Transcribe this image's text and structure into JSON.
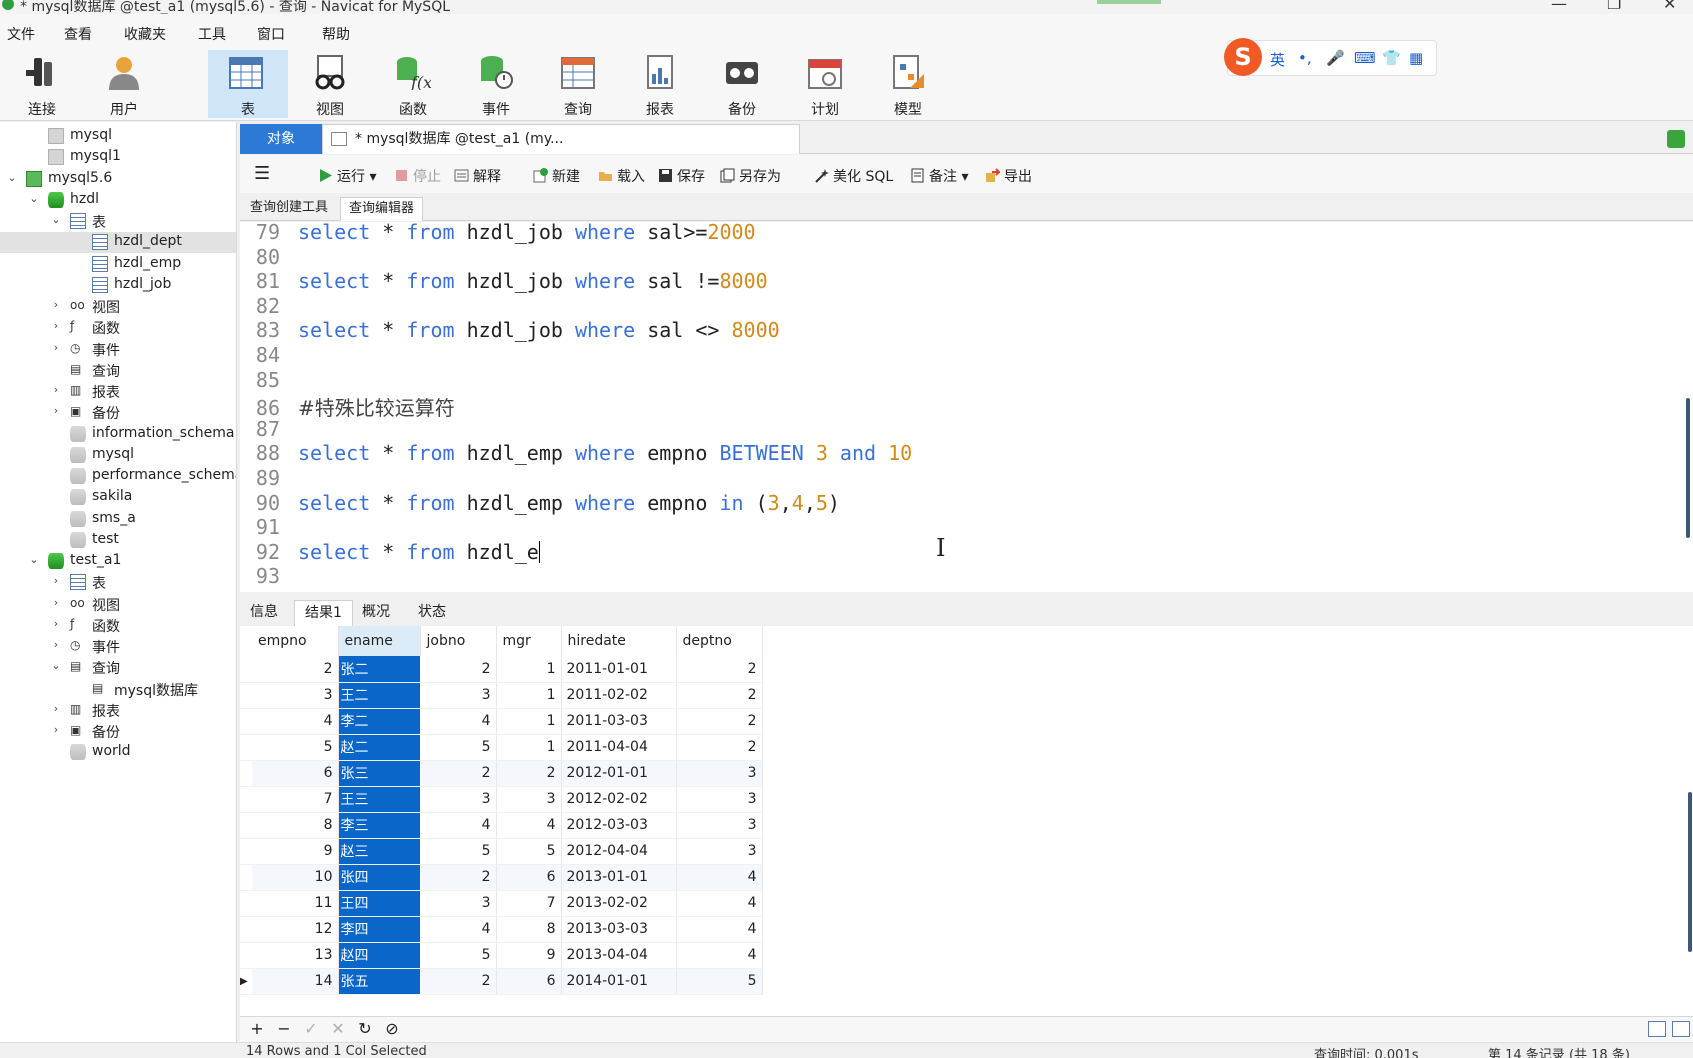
{
  "window": {
    "title": "* mysql数据库 @test_a1 (mysql5.6) - 查询 - Navicat for MySQL",
    "minimize": "—",
    "maximize": "❐",
    "close": "✕"
  },
  "menu": [
    "文件",
    "查看",
    "收藏夹",
    "工具",
    "窗口",
    "帮助"
  ],
  "ribbon": [
    {
      "label": "连接",
      "icon": "connection-icon"
    },
    {
      "label": "用户",
      "icon": "user-icon"
    },
    {
      "label": "表",
      "icon": "table-icon",
      "active": true
    },
    {
      "label": "视图",
      "icon": "view-icon"
    },
    {
      "label": "函数",
      "icon": "function-icon"
    },
    {
      "label": "事件",
      "icon": "event-icon"
    },
    {
      "label": "查询",
      "icon": "query-icon"
    },
    {
      "label": "报表",
      "icon": "report-icon"
    },
    {
      "label": "备份",
      "icon": "backup-icon"
    },
    {
      "label": "计划",
      "icon": "schedule-icon"
    },
    {
      "label": "模型",
      "icon": "model-icon"
    }
  ],
  "ime": {
    "logo": "S",
    "mode": "英",
    "punct": "•,",
    "mic": "🎤",
    "keyboard": "⌨",
    "skin": "👕",
    "apps": "▦"
  },
  "tree": [
    {
      "label": "mysql",
      "level": 1,
      "icon": "server-gray"
    },
    {
      "label": "mysql1",
      "level": 1,
      "icon": "server-gray"
    },
    {
      "label": "mysql5.6",
      "level": 0,
      "icon": "server-green",
      "expanded": true
    },
    {
      "label": "hzdl",
      "level": 1,
      "icon": "db-green",
      "expanded": true
    },
    {
      "label": "表",
      "level": 2,
      "icon": "table",
      "expanded": true
    },
    {
      "label": "hzdl_dept",
      "level": 4,
      "icon": "table",
      "selected": true
    },
    {
      "label": "hzdl_emp",
      "level": 4,
      "icon": "table"
    },
    {
      "label": "hzdl_job",
      "level": 4,
      "icon": "table"
    },
    {
      "label": "视图",
      "level": 3,
      "icon": "view",
      "collapsed": true
    },
    {
      "label": "函数",
      "level": 3,
      "icon": "function",
      "collapsed": true
    },
    {
      "label": "事件",
      "level": 3,
      "icon": "event",
      "collapsed": true
    },
    {
      "label": "查询",
      "level": 3,
      "icon": "query"
    },
    {
      "label": "报表",
      "level": 3,
      "icon": "report",
      "collapsed": true
    },
    {
      "label": "备份",
      "level": 3,
      "icon": "backup",
      "collapsed": true
    },
    {
      "label": "information_schema",
      "level": 2,
      "icon": "db-gray"
    },
    {
      "label": "mysql",
      "level": 2,
      "icon": "db-gray"
    },
    {
      "label": "performance_schema",
      "level": 2,
      "icon": "db-gray"
    },
    {
      "label": "sakila",
      "level": 2,
      "icon": "db-gray"
    },
    {
      "label": "sms_a",
      "level": 2,
      "icon": "db-gray"
    },
    {
      "label": "test",
      "level": 2,
      "icon": "db-gray"
    },
    {
      "label": "test_a1",
      "level": 1,
      "icon": "db-green",
      "expanded": true
    },
    {
      "label": "表",
      "level": 3,
      "icon": "table",
      "collapsed": true
    },
    {
      "label": "视图",
      "level": 3,
      "icon": "view",
      "collapsed": true
    },
    {
      "label": "函数",
      "level": 3,
      "icon": "function",
      "collapsed": true
    },
    {
      "label": "事件",
      "level": 3,
      "icon": "event",
      "collapsed": true
    },
    {
      "label": "查询",
      "level": 2,
      "icon": "query",
      "expanded": true
    },
    {
      "label": "mysql数据库",
      "level": 4,
      "icon": "query"
    },
    {
      "label": "报表",
      "level": 3,
      "icon": "report",
      "collapsed": true
    },
    {
      "label": "备份",
      "level": 3,
      "icon": "backup",
      "collapsed": true
    },
    {
      "label": "world",
      "level": 2,
      "icon": "db-gray"
    }
  ],
  "tabs": {
    "objects": "对象",
    "query": "* mysql数据库 @test_a1 (my..."
  },
  "query_toolbar": {
    "menu": "☰",
    "run": "运行",
    "stop": "停止",
    "explain": "解释",
    "new": "新建",
    "load": "载入",
    "save": "保存",
    "save_as": "另存为",
    "beautify": "美化 SQL",
    "comment": "备注",
    "export": "导出"
  },
  "sub_tabs": {
    "builder": "查询创建工具",
    "editor": "查询编辑器"
  },
  "editor_lines": [
    {
      "n": "79",
      "code": [
        [
          "kw",
          "select"
        ],
        [
          "t",
          " * "
        ],
        [
          "kw",
          "from"
        ],
        [
          "t",
          " hzdl_job "
        ],
        [
          "kw",
          "where"
        ],
        [
          "t",
          " sal>="
        ],
        [
          "nm",
          "2000"
        ]
      ]
    },
    {
      "n": "80",
      "code": []
    },
    {
      "n": "81",
      "code": [
        [
          "kw",
          "select"
        ],
        [
          "t",
          " * "
        ],
        [
          "kw",
          "from"
        ],
        [
          "t",
          " hzdl_job "
        ],
        [
          "kw",
          "where"
        ],
        [
          "t",
          " sal !="
        ],
        [
          "nm",
          "8000"
        ]
      ]
    },
    {
      "n": "82",
      "code": []
    },
    {
      "n": "83",
      "code": [
        [
          "kw",
          "select"
        ],
        [
          "t",
          " * "
        ],
        [
          "kw",
          "from"
        ],
        [
          "t",
          " hzdl_job "
        ],
        [
          "kw",
          "where"
        ],
        [
          "t",
          " sal <> "
        ],
        [
          "nm",
          "8000"
        ]
      ]
    },
    {
      "n": "84",
      "code": []
    },
    {
      "n": "85",
      "code": []
    },
    {
      "n": "86",
      "code": [
        [
          "c",
          "#特殊比较运算符"
        ]
      ]
    },
    {
      "n": "87",
      "code": []
    },
    {
      "n": "88",
      "code": [
        [
          "kw",
          "select"
        ],
        [
          "t",
          " * "
        ],
        [
          "kw",
          "from"
        ],
        [
          "t",
          " hzdl_emp "
        ],
        [
          "kw",
          "where"
        ],
        [
          "t",
          " empno "
        ],
        [
          "kw",
          "BETWEEN"
        ],
        [
          "t",
          " "
        ],
        [
          "nm",
          "3"
        ],
        [
          "t",
          " "
        ],
        [
          "kw",
          "and"
        ],
        [
          "t",
          " "
        ],
        [
          "nm",
          "10"
        ]
      ]
    },
    {
      "n": "89",
      "code": []
    },
    {
      "n": "90",
      "code": [
        [
          "kw",
          "select"
        ],
        [
          "t",
          " * "
        ],
        [
          "kw",
          "from"
        ],
        [
          "t",
          " hzdl_emp "
        ],
        [
          "kw",
          "where"
        ],
        [
          "t",
          " empno "
        ],
        [
          "kw",
          "in"
        ],
        [
          "t",
          " ("
        ],
        [
          "nm",
          "3"
        ],
        [
          "t",
          ","
        ],
        [
          "nm",
          "4"
        ],
        [
          "t",
          ","
        ],
        [
          "nm",
          "5"
        ],
        [
          "t",
          ")"
        ]
      ]
    },
    {
      "n": "91",
      "code": []
    },
    {
      "n": "92",
      "code": [
        [
          "kw",
          "select"
        ],
        [
          "t",
          " * "
        ],
        [
          "kw",
          "from"
        ],
        [
          "t",
          " hzdl_e"
        ],
        [
          "caret",
          ""
        ]
      ]
    },
    {
      "n": "93",
      "code": []
    }
  ],
  "result_tabs": [
    "信息",
    "结果1",
    "概况",
    "状态"
  ],
  "grid": {
    "columns": [
      "empno",
      "ename",
      "jobno",
      "mgr",
      "hiredate",
      "deptno"
    ],
    "rows": [
      [
        "2",
        "张二",
        "2",
        "1",
        "2011-01-01",
        "2"
      ],
      [
        "3",
        "王二",
        "3",
        "1",
        "2011-02-02",
        "2"
      ],
      [
        "4",
        "李二",
        "4",
        "1",
        "2011-03-03",
        "2"
      ],
      [
        "5",
        "赵二",
        "5",
        "1",
        "2011-04-04",
        "2"
      ],
      [
        "6",
        "张三",
        "2",
        "2",
        "2012-01-01",
        "3"
      ],
      [
        "7",
        "王三",
        "3",
        "3",
        "2012-02-02",
        "3"
      ],
      [
        "8",
        "李三",
        "4",
        "4",
        "2012-03-03",
        "3"
      ],
      [
        "9",
        "赵三",
        "5",
        "5",
        "2012-04-04",
        "3"
      ],
      [
        "10",
        "张四",
        "2",
        "6",
        "2013-01-01",
        "4"
      ],
      [
        "11",
        "王四",
        "3",
        "7",
        "2013-02-02",
        "4"
      ],
      [
        "12",
        "李四",
        "4",
        "8",
        "2013-03-03",
        "4"
      ],
      [
        "13",
        "赵四",
        "5",
        "9",
        "2013-04-04",
        "4"
      ],
      [
        "14",
        "张五",
        "2",
        "6",
        "2014-01-01",
        "5"
      ]
    ],
    "current_row_marker": "▶"
  },
  "grid_toolbar": {
    "add": "+",
    "remove": "−",
    "apply": "✓",
    "discard": "✕",
    "refresh": "↻",
    "stop": "⊘"
  },
  "status": {
    "selection": "14 Rows and 1 Col Selected",
    "query_time": "查询时间: 0.001s",
    "record": "第 14 条记录 (共 18 条)"
  },
  "colors": {
    "accent": "#2d7ad6",
    "selection": "#0a66c8",
    "keyword": "#3a6fd8",
    "number": "#d28a1a"
  }
}
